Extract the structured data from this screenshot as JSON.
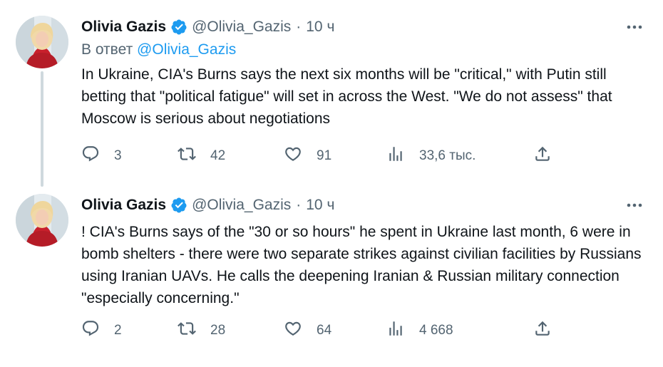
{
  "tweets": [
    {
      "author": {
        "name": "Olivia Gazis",
        "handle": "@Olivia_Gazis"
      },
      "separator": "·",
      "time": "10 ч",
      "reply_to": {
        "prefix": "В ответ",
        "mention": "@Olivia_Gazis"
      },
      "text": "In Ukraine, CIA's Burns says the next six months will be \"critical,\" with Putin still betting that \"political fatigue\" will set in across the West. \"We do not assess\" that Moscow is serious about negotiations",
      "stats": {
        "replies": "3",
        "retweets": "42",
        "likes": "91",
        "views": "33,6 тыс."
      }
    },
    {
      "author": {
        "name": "Olivia Gazis",
        "handle": "@Olivia_Gazis"
      },
      "separator": "·",
      "time": "10 ч",
      "text": "! CIA's Burns says of the \"30 or so hours\" he spent in Ukraine last month, 6 were in bomb shelters - there were two separate strikes against civilian facilities by Russians using Iranian UAVs. He calls the deepening Iranian & Russian military connection \"especially concerning.\"",
      "stats": {
        "replies": "2",
        "retweets": "28",
        "likes": "64",
        "views": "4 668"
      }
    }
  ],
  "icons": {
    "verified": "verified-badge-icon",
    "more": "more-dots-icon",
    "reply": "reply-bubble-icon",
    "retweet": "retweet-icon",
    "like": "heart-icon",
    "views": "views-bars-icon",
    "share": "share-icon"
  },
  "colors": {
    "text": "#0f1419",
    "secondary": "#536471",
    "link": "#1d9bf0",
    "verified": "#1d9bf0",
    "thread_line": "#cfd9de"
  }
}
